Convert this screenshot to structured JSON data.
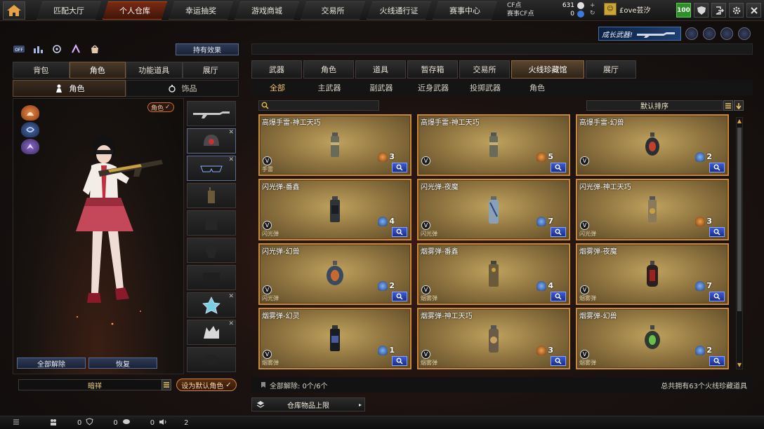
{
  "top_nav": {
    "tabs": [
      {
        "label": "匹配大厅",
        "active": false
      },
      {
        "label": "个人仓库",
        "active": true
      },
      {
        "label": "幸运抽奖",
        "active": false
      },
      {
        "label": "游戏商城",
        "active": false
      },
      {
        "label": "交易所",
        "active": false
      },
      {
        "label": "火线通行证",
        "active": false
      },
      {
        "label": "赛事中心",
        "active": false
      }
    ],
    "cf_label": "CF点",
    "cf_value": "631",
    "event_cf_label": "赛事CF点",
    "event_cf_value": "0",
    "player_name": "£ove芸汐",
    "level": "100"
  },
  "banner": {
    "text": "成长武器!"
  },
  "left_panel": {
    "hold_effect_label": "持有效果",
    "tabs": [
      "背包",
      "角色",
      "功能道具",
      "展厅"
    ],
    "active_tab": "角色",
    "sub_tabs": [
      "角色",
      "饰品"
    ],
    "active_sub_tab": "角色",
    "role_badge": "角色",
    "unequip_all_label": "全部解除",
    "restore_label": "恢复",
    "character_name": "暗祥",
    "set_default_label": "设为默认角色"
  },
  "right_panel": {
    "main_tabs": [
      "武器",
      "角色",
      "道具",
      "暂存箱",
      "交易所",
      "火线珍藏馆",
      "展厅"
    ],
    "active_main_tab": "火线珍藏馆",
    "categories": [
      "全部",
      "主武器",
      "副武器",
      "近身武器",
      "投掷武器",
      "角色"
    ],
    "active_category": "全部",
    "sort_label": "默认排序",
    "items": [
      {
        "name": "高爆手雷-神工天巧",
        "type": "手雷",
        "count": "3",
        "rarity": "orange",
        "img": "smoke"
      },
      {
        "name": "高爆手雷-神工天巧",
        "type": "",
        "count": "5",
        "rarity": "orange",
        "img": "smoke"
      },
      {
        "name": "高爆手雷-幻兽",
        "type": "",
        "count": "2",
        "rarity": "blue",
        "img": "grenade-dark"
      },
      {
        "name": "闪光弹-番鑫",
        "type": "闪光弹",
        "count": "4",
        "rarity": "blue",
        "img": "flash"
      },
      {
        "name": "闪光弹-夜魔",
        "type": "闪光弹",
        "count": "7",
        "rarity": "blue",
        "img": "flash-blue"
      },
      {
        "name": "闪光弹-神工天巧",
        "type": "闪光弹",
        "count": "3",
        "rarity": "orange",
        "img": "flash-gold"
      },
      {
        "name": "闪光弹-幻兽",
        "type": "闪光弹",
        "count": "2",
        "rarity": "blue",
        "img": "grenade-blue"
      },
      {
        "name": "烟雾弹-番鑫",
        "type": "烟雾弹",
        "count": "4",
        "rarity": "blue",
        "img": "smoke-brown"
      },
      {
        "name": "烟雾弹-夜魔",
        "type": "烟雾弹",
        "count": "7",
        "rarity": "blue",
        "img": "grenade-red"
      },
      {
        "name": "烟雾弹-幻灵",
        "type": "烟雾弹",
        "count": "1",
        "rarity": "blue",
        "img": "smoke-dark"
      },
      {
        "name": "烟雾弹-神工天巧",
        "type": "烟雾弹",
        "count": "3",
        "rarity": "orange",
        "img": "smoke-ornate"
      },
      {
        "name": "烟雾弹-幻兽",
        "type": "烟雾弹",
        "count": "2",
        "rarity": "blue",
        "img": "grenade-green"
      }
    ],
    "unequip_all_text": "全部解除: 0个/6个",
    "total_text": "总共拥有63个火线珍藏道具",
    "capacity_label": "仓库物品上限"
  },
  "statusbar": {
    "values": [
      "0",
      "0",
      "0",
      "2"
    ]
  },
  "colors": {
    "accent_orange": "#d4863a",
    "rarity_orange": "#f0a04a",
    "rarity_blue": "#7fb0ff",
    "level_green": "#2f8f2a",
    "card_gold": "#bfa25e"
  }
}
